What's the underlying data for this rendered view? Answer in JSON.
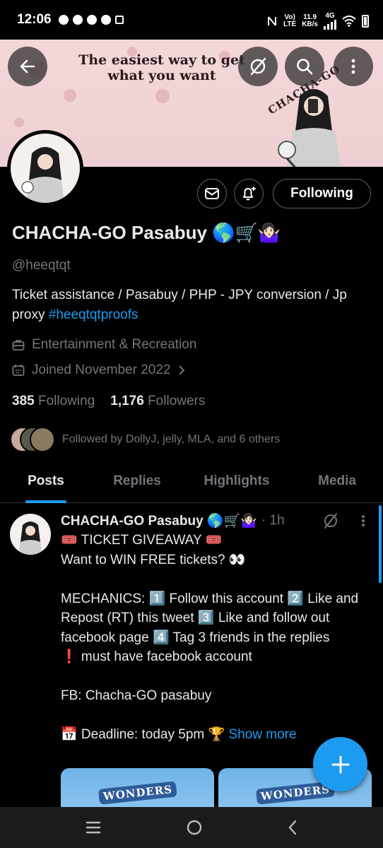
{
  "status_bar": {
    "time": "12:06",
    "network_type_top": "Vo)",
    "network_type_bottom": "LTE",
    "speed_value": "11.9",
    "speed_unit": "KB/s",
    "cell_gen": "4G"
  },
  "banner": {
    "tagline": "The easiest way to get what you want",
    "brand": "CHACHA-GO",
    "background_color": "#f3d7d9"
  },
  "profile": {
    "name": "CHACHA-GO Pasabuy 🌎🛒🤷🏻‍♀️",
    "handle": "@heeqtqt",
    "bio_text": "Ticket assistance / Pasabuy / PHP - JPY conversion / Jp proxy ",
    "bio_hashtag": "#heeqtqtproofs",
    "category": "Entertainment & Recreation",
    "joined": "Joined November 2022",
    "following_count": "385",
    "following_label": "Following",
    "followers_count": "1,176",
    "followers_label": "Followers",
    "followed_by": "Followed by DollyJ, jelly, MLA, and 6 others",
    "follow_button_label": "Following"
  },
  "tabs": [
    {
      "label": "Posts",
      "active": true
    },
    {
      "label": "Replies",
      "active": false
    },
    {
      "label": "Highlights",
      "active": false
    },
    {
      "label": "Media",
      "active": false
    }
  ],
  "post": {
    "author": "CHACHA-GO Pasabuy 🌎🛒🤷🏻‍♀️",
    "time": "· 1h",
    "body": "🎟️ TICKET GIVEAWAY 🎟️\nWant to WIN FREE tickets? 👀\n\nMECHANICS:  1️⃣ Follow this account  2️⃣ Like and Repost (RT) this tweet  3️⃣ Like and follow out facebook page  4️⃣ Tag 3 friends in the replies\n❗ must have facebook account\n\nFB: Chacha-GO pasabuy\n\n📅 Deadline: today 5pm  🏆 ",
    "show_more": "Show more",
    "media_label_1": "WONDERS",
    "media_label_2": "WONDERS"
  },
  "colors": {
    "accent": "#1d9bf0",
    "background": "#000000",
    "muted_text": "#71767b",
    "primary_text": "#e7e9ea"
  },
  "icons": {
    "back": "arrow-left-icon",
    "grok": "slash-circle-icon",
    "search": "search-icon",
    "more": "more-vertical-icon",
    "message": "envelope-icon",
    "notify": "bell-plus-icon",
    "category": "briefcase-icon",
    "calendar": "calendar-icon",
    "compose": "plus-icon"
  }
}
